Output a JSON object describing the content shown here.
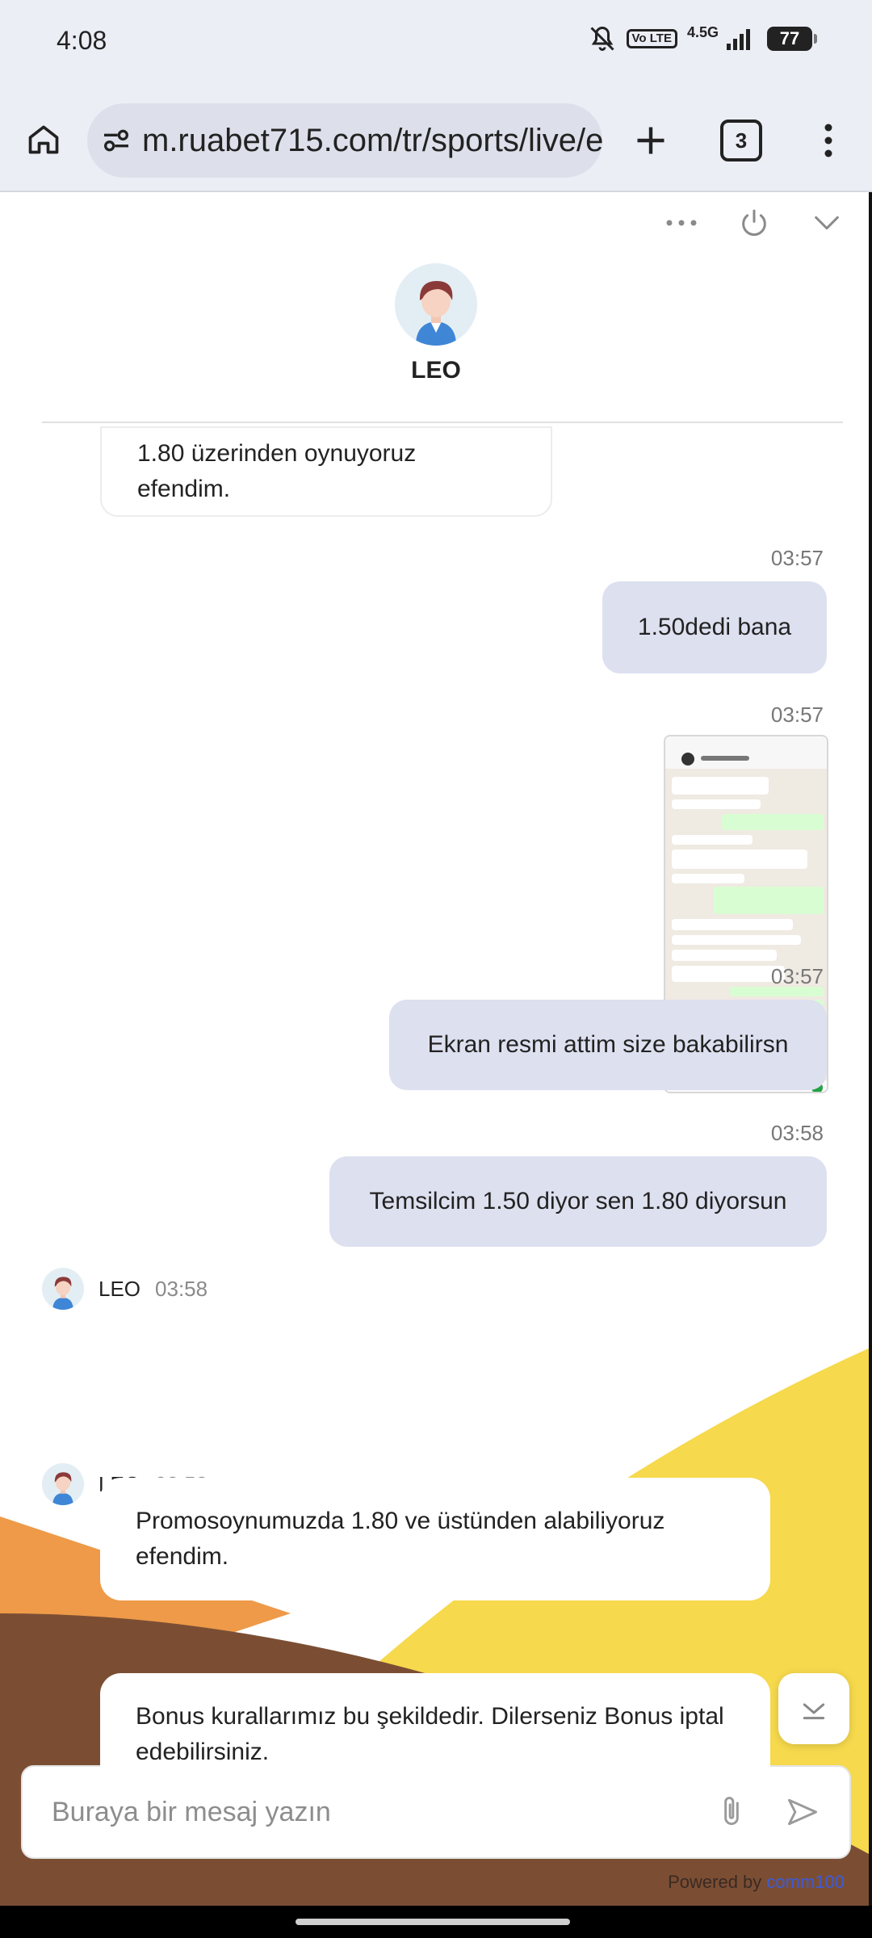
{
  "status_bar": {
    "time": "4:08",
    "volte_label": "Vo LTE",
    "network_label": "4.5G",
    "battery_level": "77"
  },
  "browser": {
    "url": "m.ruabet715.com/tr/sports/live/e",
    "tab_count": "3"
  },
  "chat": {
    "agent_name": "LEO",
    "messages": [
      {
        "from": "agent",
        "text": "1.80 üzerinden oynuyoruz efendim."
      },
      {
        "from": "user",
        "time": "03:57",
        "text": "1.50dedi bana"
      },
      {
        "from": "user",
        "time": "03:57",
        "type": "image"
      },
      {
        "from": "user",
        "time": "03:57",
        "text": "Ekran resmi attim size bakabilirsn"
      },
      {
        "from": "user",
        "time": "03:58",
        "text": "Temsilcim 1.50 diyor sen 1.80 diyorsun"
      },
      {
        "from": "agent",
        "sender": "LEO",
        "time": "03:58",
        "text": "Promosoynumuzda 1.80 ve üstünden alabiliyoruz efendim."
      },
      {
        "from": "agent",
        "sender": "LEO",
        "time": "03:58",
        "text": "Bonus kurallarımız bu şekildedir. Dilerseniz Bonus iptal edebilirsiniz."
      }
    ],
    "composer_placeholder": "Buraya bir mesaj yazın",
    "powered_by": "Powered by",
    "powered_brand": "comm100"
  },
  "colors": {
    "user_bubble": "#dde0ef",
    "yellow_shape": "#f6d94c",
    "orange_shape": "#ee9a48",
    "brown_shape": "#7b4e34",
    "brand_link": "#3b5bdb"
  },
  "icons": [
    "home-icon",
    "site-info-icon",
    "plus-icon",
    "tabs-icon",
    "more-vert-icon",
    "more-horiz-icon",
    "power-icon",
    "chevron-down-icon",
    "attach-icon",
    "send-icon"
  ]
}
